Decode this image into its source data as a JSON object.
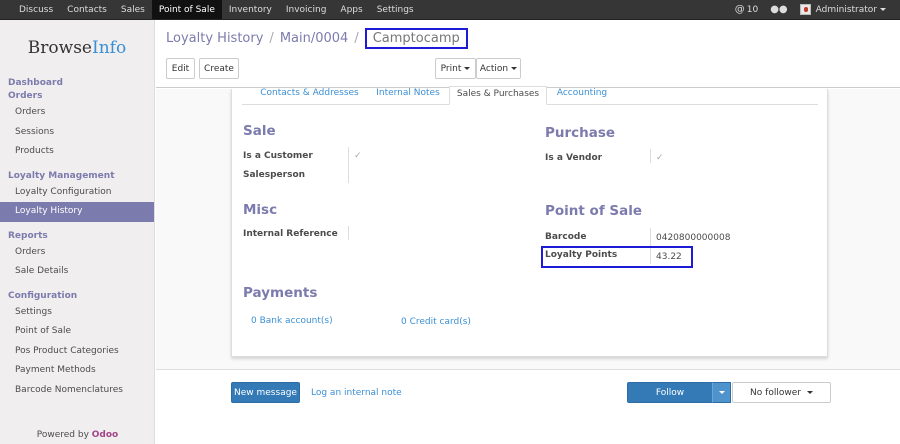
{
  "topbar": {
    "menu": [
      "Discuss",
      "Contacts",
      "Sales",
      "Point of Sale",
      "Inventory",
      "Invoicing",
      "Apps",
      "Settings"
    ],
    "active": "Point of Sale",
    "notifications": "10",
    "user": "Administrator"
  },
  "sidebar": {
    "logo_a": "Browse",
    "logo_b": "Info",
    "sections": [
      {
        "head": "Dashboard",
        "items": []
      },
      {
        "head": "Orders",
        "items": [
          "Orders",
          "Sessions",
          "Products"
        ]
      },
      {
        "head": "Loyalty Management",
        "items": [
          "Loyalty Configuration",
          "Loyalty History"
        ]
      },
      {
        "head": "Reports",
        "items": [
          "Orders",
          "Sale Details"
        ]
      },
      {
        "head": "Configuration",
        "items": [
          "Settings",
          "Point of Sale",
          "Pos Product Categories",
          "Payment Methods",
          "Barcode Nomenclatures"
        ]
      }
    ],
    "active_item": "Loyalty History",
    "powered_by": "Powered by",
    "powered_brand": "Odoo"
  },
  "breadcrumb": {
    "root": "Loyalty History",
    "mid": "Main/0004",
    "current": "Camptocamp"
  },
  "buttons": {
    "edit": "Edit",
    "create": "Create",
    "print": "Print",
    "action": "Action"
  },
  "tabs": [
    {
      "label": "Contacts & Addresses"
    },
    {
      "label": "Internal Notes"
    },
    {
      "label": "Sales & Purchases",
      "active": true
    },
    {
      "label": "Accounting"
    }
  ],
  "form": {
    "sale": {
      "title": "Sale",
      "is_customer": "Is a Customer",
      "salesperson": "Salesperson"
    },
    "purchase": {
      "title": "Purchase",
      "is_vendor": "Is a Vendor"
    },
    "misc": {
      "title": "Misc",
      "internal_reference": "Internal Reference"
    },
    "pos": {
      "title": "Point of Sale",
      "barcode_label": "Barcode",
      "barcode_value": "0420800000008",
      "loyalty_label": "Loyalty Points",
      "loyalty_value": "43.22"
    },
    "payments": {
      "title": "Payments",
      "bank": "0 Bank account(s)",
      "credit": "0 Credit card(s)"
    }
  },
  "chatter": {
    "new_message": "New message",
    "log_note": "Log an internal note",
    "follow": "Follow",
    "followers": "No follower"
  }
}
